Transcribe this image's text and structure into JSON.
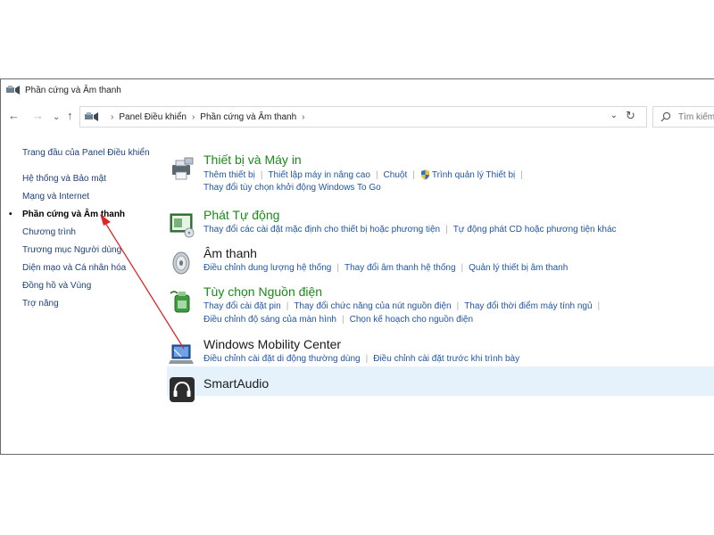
{
  "window": {
    "title": "Phần cứng và Âm thanh"
  },
  "nav": {
    "back": "←",
    "forward": "→",
    "recent": "⌄",
    "up": "↑"
  },
  "address": {
    "crumbs": [
      "Panel Điều khiển",
      "Phần cứng và Âm thanh"
    ],
    "sep": "›",
    "dropdown": "⌄",
    "refresh": "↻"
  },
  "search": {
    "placeholder": "Tìm kiếm"
  },
  "sidebar": {
    "items": [
      {
        "label": "Trang đầu của Panel Điều khiển"
      },
      {
        "label": "Hệ thống và Bảo mật"
      },
      {
        "label": "Mạng và Internet"
      },
      {
        "label": "Phần cứng và Âm thanh",
        "active": true
      },
      {
        "label": "Chương trình"
      },
      {
        "label": "Trương mục Người dùng"
      },
      {
        "label": "Diện mạo và Cá nhân hóa"
      },
      {
        "label": "Đồng hồ và Vùng"
      },
      {
        "label": "Trợ năng"
      }
    ],
    "bullet": "•"
  },
  "categories": [
    {
      "title": "Thiết bị và Máy in",
      "link_rows": [
        [
          "Thêm thiết bị",
          "Thiết lập máy in nâng cao",
          "Chuột",
          "Trình quản lý Thiết bị"
        ],
        [
          "Thay đổi tùy chọn khởi động Windows To Go"
        ]
      ]
    },
    {
      "title": "Phát Tự động",
      "link_rows": [
        [
          "Thay đổi các cài đặt mặc định cho thiết bị hoặc phương tiện",
          "Tự động phát CD hoặc phương tiện khác"
        ]
      ]
    },
    {
      "title": "Âm thanh",
      "link_rows": [
        [
          "Điều chỉnh dung lượng hệ thống",
          "Thay đổi âm thanh hệ thống",
          "Quản lý thiết bị âm thanh"
        ]
      ]
    },
    {
      "title": "Tùy chọn Nguồn điện",
      "link_rows": [
        [
          "Thay đổi cài đặt pin",
          "Thay đổi chức năng của nút nguồn điện",
          "Thay đổi thời điểm máy tính ngủ"
        ],
        [
          "Điều chỉnh độ sáng của màn hình",
          "Chọn kế hoạch cho nguồn điện"
        ]
      ]
    },
    {
      "title": "Windows Mobility Center",
      "link_rows": [
        [
          "Điều chỉnh cài đặt di động thường dùng",
          "Điều chỉnh cài đặt trước khi trình bày"
        ]
      ]
    },
    {
      "title": "SmartAudio",
      "link_rows": []
    }
  ],
  "colors": {
    "accent_green": "#1a8a1a",
    "link_blue": "#1f55a5",
    "sidebar_blue": "#1e3f7a",
    "highlight": "#e5f1fb",
    "annotation_red": "#e02424"
  }
}
